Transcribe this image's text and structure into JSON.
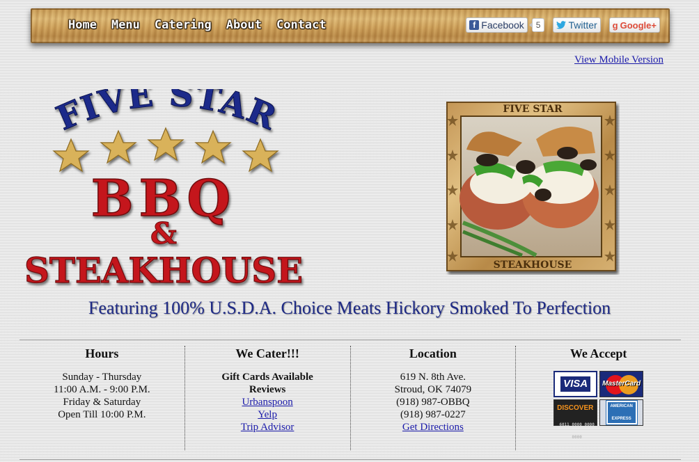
{
  "nav": {
    "links": [
      "Home",
      "Menu",
      "Catering",
      "About",
      "Contact"
    ]
  },
  "social": {
    "facebook_label": "Facebook",
    "facebook_count": "5",
    "twitter_label": "Twitter",
    "google_label": "Google+"
  },
  "mobile_link": "View Mobile Version",
  "logo": {
    "line1": "FIVE STAR",
    "line2": "BBQ",
    "line3": "&",
    "line4": "STEAKHOUSE"
  },
  "featured_image": {
    "top_text": "FIVE STAR",
    "bottom_text": "STEAKHOUSE"
  },
  "tagline": "Featuring 100% U.S.D.A. Choice Meats Hickory Smoked To Perfection",
  "hours": {
    "title": "Hours",
    "lines": [
      "Sunday - Thursday",
      "11:00 A.M. - 9:00 P.M.",
      "Friday & Saturday",
      "Open Till 10:00 P.M."
    ]
  },
  "cater": {
    "title": "We Cater!!!",
    "gift": "Gift Cards Available",
    "reviews": "Reviews",
    "links": [
      "Urbanspoon",
      "Yelp",
      "Trip Advisor"
    ]
  },
  "location": {
    "title": "Location",
    "lines": [
      "619 N. 8th Ave.",
      "Stroud, OK 74079",
      "(918) 987-OBBQ",
      "(918) 987-0227"
    ],
    "directions": "Get Directions"
  },
  "accept": {
    "title": "We Accept",
    "cards": [
      "VISA",
      "MasterCard",
      "DISCOVER",
      "AMERICAN EXPRESS"
    ]
  },
  "colors": {
    "logo_blue": "#1a2a8a",
    "logo_red": "#c4141c",
    "star_gold": "#d9b25a",
    "tagline": "#1e2a86",
    "link": "#1a1aaa"
  }
}
